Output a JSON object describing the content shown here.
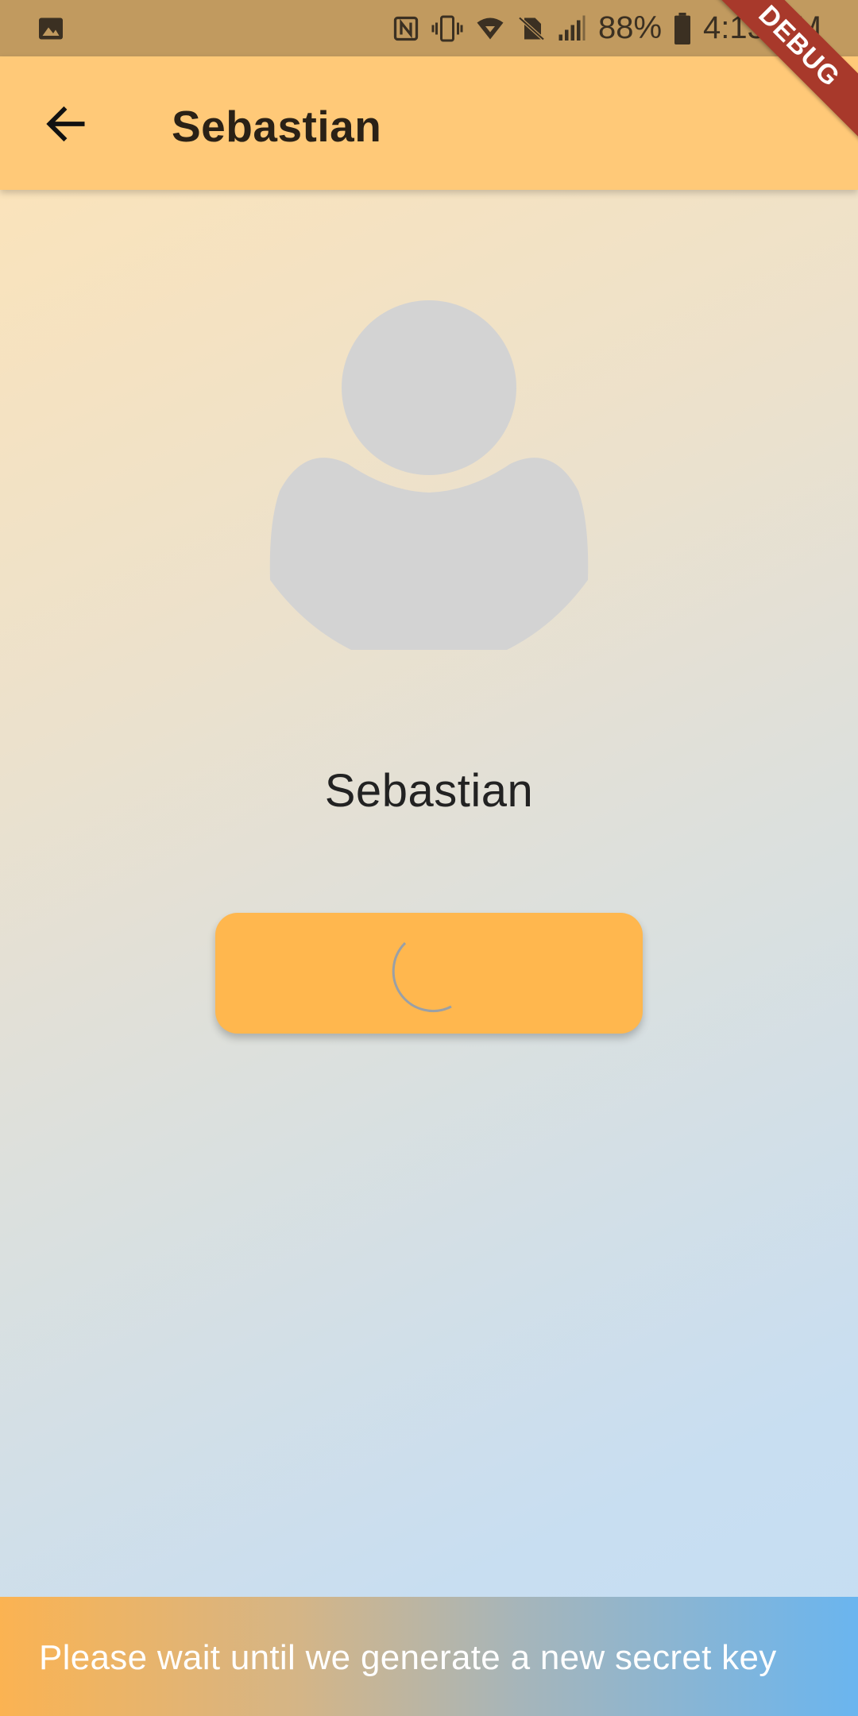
{
  "status_bar": {
    "battery_percent": "88%",
    "time": "4:13 PM",
    "icons": [
      "image-icon",
      "nfc-icon",
      "vibrate-icon",
      "wifi-icon",
      "no-sim-icon",
      "signal-icon",
      "battery-icon"
    ]
  },
  "app_bar": {
    "title": "Sebastian",
    "back_icon": "arrow-back-icon"
  },
  "debug_banner": "DEBUG",
  "profile": {
    "name": "Sebastian",
    "avatar_icon": "person-placeholder-icon"
  },
  "action_button": {
    "state": "loading",
    "spinner_icon": "circular-progress-icon"
  },
  "snackbar": {
    "message": "Please wait until we generate a new secret key"
  },
  "colors": {
    "status_bar": "#c19a5f",
    "app_bar": "#ffc978",
    "button": "#ffb74e",
    "avatar": "#d3d3d3",
    "debug": "#a8392b"
  }
}
